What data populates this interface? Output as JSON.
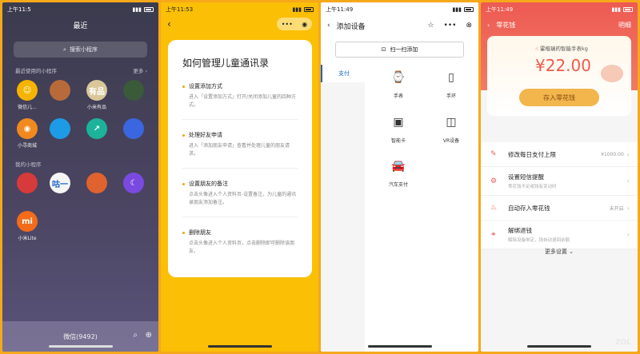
{
  "screen1": {
    "status_time": "上午11:5",
    "title": "最近",
    "search_placeholder": "搜索小程序",
    "recent_label": "最近使用的小程序",
    "more_label": "更多",
    "recent_apps": [
      {
        "label": "微信儿...",
        "color": "#f4b400",
        "glyph": "☺"
      },
      {
        "label": "",
        "color": "#b86a3a",
        "glyph": ""
      },
      {
        "label": "小米有品",
        "color": "#d9c79a",
        "glyph": "有品"
      },
      {
        "label": "",
        "color": "#3a5a3a",
        "glyph": ""
      },
      {
        "label": "小寻商城",
        "color": "#f08a1f",
        "glyph": "◉"
      },
      {
        "label": "",
        "color": "#1e9be6",
        "glyph": ""
      },
      {
        "label": "",
        "color": "#1cb39a",
        "glyph": "↗"
      },
      {
        "label": "",
        "color": "#3a66e0",
        "glyph": ""
      }
    ],
    "my_label": "我的小程序",
    "my_apps": [
      {
        "label": "",
        "color": "#d73a3a",
        "glyph": ""
      },
      {
        "label": "",
        "color": "#f5f5f5",
        "glyph": "咕一"
      },
      {
        "label": "",
        "color": "#e0622f",
        "glyph": ""
      },
      {
        "label": "",
        "color": "#7a4ae0",
        "glyph": "☾"
      },
      {
        "label": "小米Lite",
        "color": "#f26c1a",
        "glyph": "mi"
      }
    ],
    "bottom_label": "微信(9492)"
  },
  "screen2": {
    "status_time": "上午11:53",
    "card_title": "如何管理儿童通讯录",
    "steps": [
      {
        "title": "设置添加方式",
        "desc": "进入「设置添加方式」打开/关闭添加儿童的四种方式。"
      },
      {
        "title": "处理好友申请",
        "desc": "进入「添加朋友申请」查看并处理儿童的朋友请求。"
      },
      {
        "title": "设置朋友的备注",
        "desc": "点击头像进入个人资料页-设置备注，为儿童的通讯录朋友添加备注。"
      },
      {
        "title": "删除朋友",
        "desc": "点击头像进入个人资料页，点击删除即可删除该朋友。"
      }
    ]
  },
  "screen3": {
    "status_time": "上午11:49",
    "title": "添加设备",
    "scan_label": "扫一扫添加",
    "side_tab": "支付",
    "devices": [
      {
        "label": "手表",
        "glyph": "⌚"
      },
      {
        "label": "手环",
        "glyph": "▯"
      },
      {
        "label": "智能卡",
        "glyph": "▣"
      },
      {
        "label": "VR设备",
        "glyph": "◫"
      },
      {
        "label": "汽车支付",
        "glyph": "🚘"
      }
    ]
  },
  "screen4": {
    "status_time": "上午11:49",
    "title": "零花钱",
    "detail_label": "明细",
    "owner_text": "霍楷瑞的智能手表kg",
    "amount": "¥22.00",
    "deposit_button": "存入零花钱",
    "rows": [
      {
        "title": "修改每日支付上限",
        "sub": "",
        "value": "¥1000.00",
        "icon": "✎"
      },
      {
        "title": "设置短信提醒",
        "sub": "零花钱不足或钱有变动时",
        "value": "",
        "icon": "⚙"
      },
      {
        "title": "自动存入零花钱",
        "sub": "",
        "value": "未开启",
        "icon": "♨"
      },
      {
        "title": "解绑退钱",
        "sub": "解除设备绑定，钱自动退回余额",
        "value": "",
        "icon": "⚭"
      }
    ],
    "more_settings": "更多设置",
    "watermark": "ZOL"
  }
}
